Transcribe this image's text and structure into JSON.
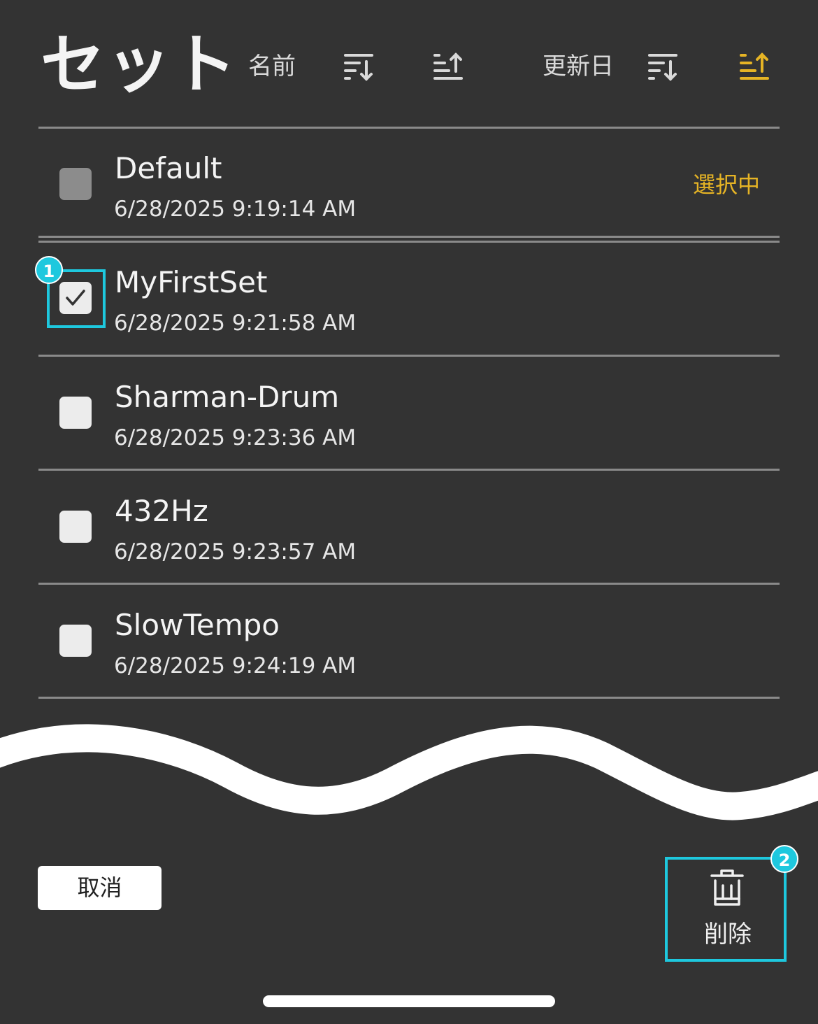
{
  "header": {
    "title": "セット",
    "sort_name_label": "名前",
    "sort_date_label": "更新日"
  },
  "colors": {
    "background": "#333333",
    "accent": "#e6b425",
    "annotation": "#1ec8de",
    "text": "#f4f4f4"
  },
  "sets": [
    {
      "name": "Default",
      "date": "6/28/2025 9:19:14 AM",
      "status": "選択中",
      "checked": false,
      "disabled": true
    },
    {
      "name": "MyFirstSet",
      "date": "6/28/2025 9:21:58 AM",
      "status": "",
      "checked": true,
      "disabled": false
    },
    {
      "name": "Sharman-Drum",
      "date": "6/28/2025 9:23:36 AM",
      "status": "",
      "checked": false,
      "disabled": false
    },
    {
      "name": "432Hz",
      "date": "6/28/2025 9:23:57 AM",
      "status": "",
      "checked": false,
      "disabled": false
    },
    {
      "name": "SlowTempo",
      "date": "6/28/2025 9:24:19 AM",
      "status": "",
      "checked": false,
      "disabled": false
    }
  ],
  "footer": {
    "cancel_label": "取消",
    "delete_label": "削除"
  },
  "annotations": {
    "badge_1": "1",
    "badge_2": "2"
  },
  "icons": {
    "sort_name_desc": "sort-descending-icon",
    "sort_name_asc": "sort-ascending-icon",
    "sort_date_desc": "sort-descending-icon",
    "sort_date_asc": "sort-ascending-icon",
    "delete": "trash-icon",
    "check": "checkmark-icon"
  }
}
